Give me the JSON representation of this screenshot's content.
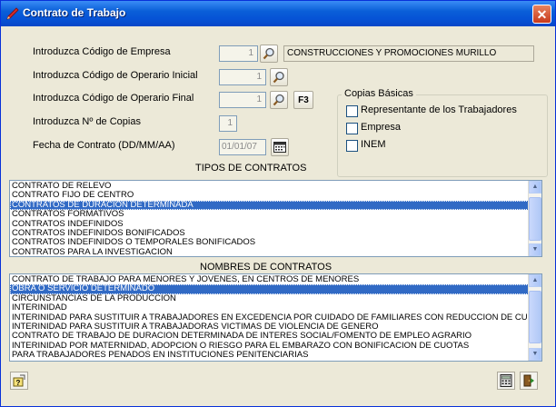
{
  "window": {
    "title": "Contrato de Trabajo",
    "close_glyph": "✕"
  },
  "form": {
    "empresa_label": "Introduzca Código de Empresa",
    "empresa_value": "1",
    "empresa_name": "CONSTRUCCIONES Y PROMOCIONES MURILLO",
    "op_ini_label": "Introduzca Código de Operario Inicial",
    "op_ini_value": "1",
    "op_fin_label": "Introduzca Código de Operario Final",
    "op_fin_value": "1",
    "f3_label": "F3",
    "copias_label": "Introduzca Nº de Copias",
    "copias_value": "1",
    "fecha_label": "Fecha de Contrato (DD/MM/AA)",
    "fecha_value": "01/01/07"
  },
  "copias_basicas": {
    "title": "Copias Básicas",
    "options": [
      {
        "label": "Representante de los Trabajadores",
        "checked": false
      },
      {
        "label": "Empresa",
        "checked": false
      },
      {
        "label": "INEM",
        "checked": false
      }
    ]
  },
  "tipos": {
    "title": "TIPOS DE CONTRATOS",
    "items": [
      "CONTRATO DE RELEVO",
      "CONTRATO FIJO DE CENTRO",
      "CONTRATOS DE DURACION DETERMINADA",
      "CONTRATOS FORMATIVOS",
      "CONTRATOS INDEFINIDOS",
      "CONTRATOS INDEFINIDOS BONIFICADOS",
      "CONTRATOS INDEFINIDOS O TEMPORALES BONIFICADOS",
      "CONTRATOS PARA LA INVESTIGACION"
    ],
    "selected_index": 2
  },
  "nombres": {
    "title": "NOMBRES DE CONTRATOS",
    "items": [
      "CONTRATO DE TRABAJO PARA MENORES Y JOVENES, EN CENTROS DE MENORES",
      "OBRA O SERVICIO DETERMINADO",
      "CIRCUNSTANCIAS DE LA PRODUCCION",
      "INTERINIDAD",
      "INTERINIDAD PARA SUSTITUIR A TRABAJADORES EN EXCEDENCIA POR CUIDADO DE FAMILIARES CON REDUCCION DE CUOTAS A LA S",
      "INTERINIDAD PARA SUSTITUIR A TRABAJADORAS VICTIMAS DE VIOLENCIA DE GENERO",
      "CONTRATO DE TRABAJO DE DURACION DETERMINADA DE INTERÉS SOCIAL/FOMENTO DE EMPLEO AGRARIO",
      "INTERINIDAD POR MATERNIDAD, ADOPCION O RIESGO PARA EL EMBARAZO CON BONIFICACION DE CUOTAS",
      "PARA TRABAJADORES PENADOS EN INSTITUCIONES PENITENCIARIAS"
    ],
    "selected_index": 1
  },
  "icons": {
    "app": "app-pen-icon",
    "search": "magnifier-icon",
    "calendar": "calendar-icon",
    "help": "help-icon",
    "calculator": "calculator-icon",
    "exit": "exit-door-icon"
  },
  "colors": {
    "selection": "#316ac5",
    "titlebar": "#0a5fd8",
    "face": "#ece9d8"
  }
}
